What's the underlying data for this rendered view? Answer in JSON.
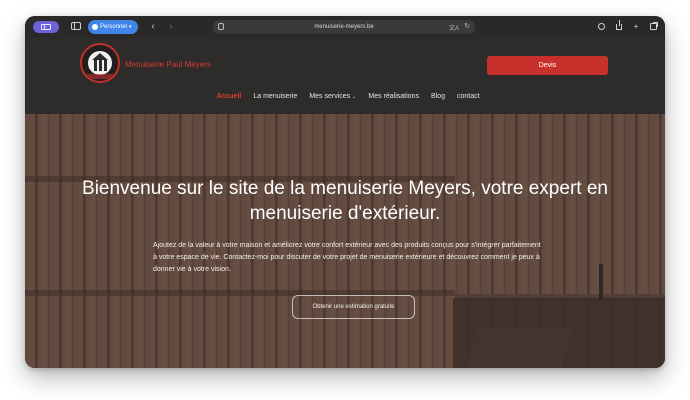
{
  "browser": {
    "profile_label": "Personnel",
    "url": "menuiserie-meyers.be",
    "back_glyph": "‹",
    "forward_glyph": "›",
    "icons": [
      "sidebar-icon",
      "tab-overview-icon",
      "person-icon",
      "chevron-down-icon",
      "back-arrow-icon",
      "forward-arrow-icon",
      "site-settings-icon",
      "translate-icon",
      "reload-icon",
      "downloads-icon",
      "share-icon",
      "new-tab-icon",
      "tabs-icon"
    ],
    "colors": {
      "sidebar_pill": "#6f62d8",
      "profile": "#3f86e8"
    }
  },
  "header": {
    "brand": "Menuiserie Paul Meyers",
    "devis_label": "Devis",
    "menu": [
      {
        "label": "Accueil",
        "active": true
      },
      {
        "label": "La menuiserie"
      },
      {
        "label": "Mes services",
        "dropdown": true
      },
      {
        "label": "Mes réalisations"
      },
      {
        "label": "Blog"
      },
      {
        "label": "contact"
      }
    ],
    "colors": {
      "accent": "#c8312b",
      "background": "#2e2c2b"
    }
  },
  "hero": {
    "title": "Bienvenue sur le site de la menuiserie Meyers, votre expert en menuiserie d'extérieur.",
    "text": "Ajoutez de la valeur à votre maison et améliorez votre confort extérieur avec des produits conçus pour s'intégrer parfaitement à votre espace de vie. Contactez-moi pour discuter de votre projet de menuiserie extérieure et découvrez comment je peux à donner vie à votre vision.",
    "cta_label": "Obtenir une estimation gratuite"
  }
}
